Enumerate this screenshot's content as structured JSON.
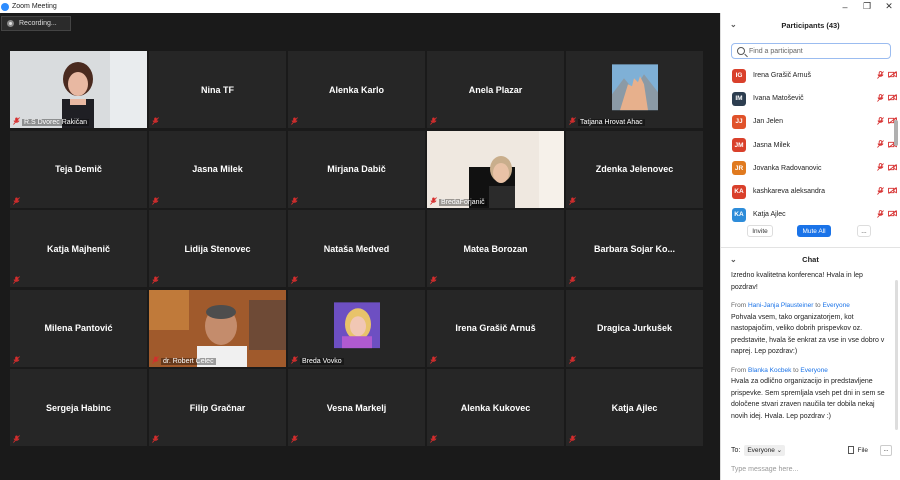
{
  "window": {
    "title": "Zoom Meeting"
  },
  "recording": "Recording...",
  "tiles": [
    {
      "name": "R.S Dvorec Rakičan",
      "video": "woman-office",
      "label": true
    },
    {
      "name": "Nina TF"
    },
    {
      "name": "Alenka Karlo"
    },
    {
      "name": "Anela Plazar"
    },
    {
      "name": "Tatjana Hrovat Ahac",
      "video": "hands-mountains",
      "label": true
    },
    {
      "name": "Teja Demič"
    },
    {
      "name": "Jasna Milek"
    },
    {
      "name": "Mirjana Dabič"
    },
    {
      "name": "BredaForjanič",
      "video": "woman-desk",
      "label": true
    },
    {
      "name": "Zdenka Jelenovec"
    },
    {
      "name": "Katja Majhenič"
    },
    {
      "name": "Lidija Stenovec"
    },
    {
      "name": "Nataša Medved"
    },
    {
      "name": "Matea Borozan"
    },
    {
      "name": "Barbara Sojar Ko..."
    },
    {
      "name": "Milena Pantović"
    },
    {
      "name": "dr. Robert Celec",
      "video": "man-room",
      "label": true,
      "speaking": true
    },
    {
      "name": "Breda Vovko",
      "video": "portrait-purple",
      "label": true
    },
    {
      "name": "Irena Grašič Arnuš"
    },
    {
      "name": "Dragica Jurkušek"
    },
    {
      "name": "Sergeja Habinc"
    },
    {
      "name": "Filip Gračnar"
    },
    {
      "name": "Vesna Markelj"
    },
    {
      "name": "Alenka Kukovec"
    },
    {
      "name": "Katja Ajlec"
    }
  ],
  "participants": {
    "title": "Participants (43)",
    "search_placeholder": "Find a participant",
    "list": [
      {
        "initials": "IG",
        "name": "Irena Grašič Arnuš",
        "color": "#d9402b"
      },
      {
        "initials": "IM",
        "name": "Ivana Matoševič",
        "color": "#2d3e50"
      },
      {
        "initials": "JJ",
        "name": "Jan Jelen",
        "color": "#e0522a"
      },
      {
        "initials": "JM",
        "name": "Jasna Milek",
        "color": "#d9402b"
      },
      {
        "initials": "JR",
        "name": "Jovanka Radovanovic",
        "color": "#e07a1f"
      },
      {
        "initials": "KA",
        "name": "kashkareva aleksandra",
        "color": "#d9402b"
      },
      {
        "initials": "KA",
        "name": "Katja Ajlec",
        "color": "#2d8cd9"
      }
    ],
    "invite": "Invite",
    "mute_all": "Mute All",
    "more": "..."
  },
  "chat": {
    "title": "Chat",
    "messages": [
      {
        "from": "",
        "to": "",
        "text": "Izredno kvalitetna konferenca! Hvala in lep pozdrav!"
      },
      {
        "from": "Hani-Janja Plausteiner",
        "to": "Everyone",
        "text": "Pohvala vsem, tako organizatorjem, kot nastopajočim, veliko dobrih prispevkov oz. predstavite, hvala  še enkrat za vse in vse dobro v naprej. Lep pozdrav:)"
      },
      {
        "from": "Blanka Kocbek",
        "to": "Everyone",
        "text": "Hvala za odlično organizacijo in predstavljene prispevke. Sem spremljala vseh pet dni in sem se določene stvari zraven naučila ter dobila nekaj novih idej. Hvala. Lep pozdrav :)"
      }
    ],
    "from_word": "From",
    "to_word": "to",
    "to_label": "To:",
    "recipient": "Everyone",
    "file": "File",
    "more": "...",
    "placeholder": "Type message here..."
  }
}
